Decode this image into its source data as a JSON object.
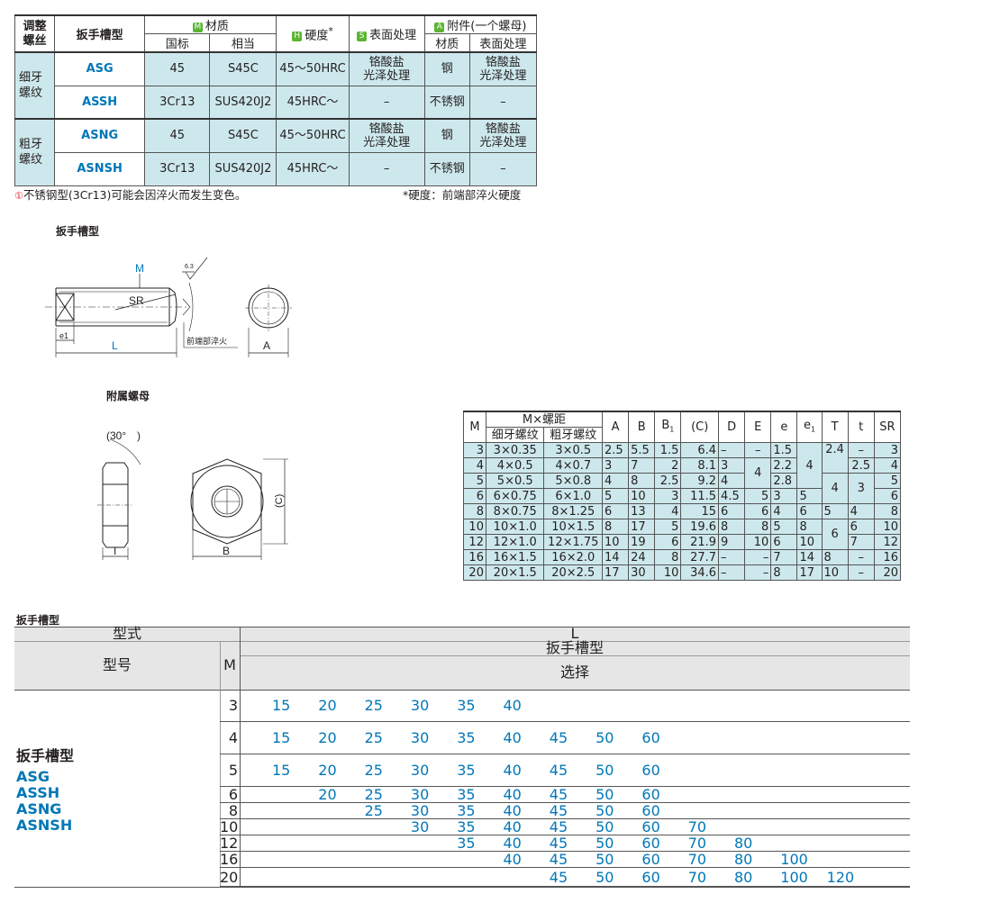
{
  "mat_table": {
    "h_adjust": "调整\n螺丝",
    "h_wrench": "扳手槽型",
    "h_material": "材质",
    "h_gb": "国标",
    "h_equiv": "相当",
    "h_hardness": "硬度",
    "h_hardness_star": "*",
    "h_surface": "表面处理",
    "h_attach": "附件(一个螺母)",
    "h_attach_mat": "材质",
    "h_attach_surf": "表面处理",
    "badge_m": "M",
    "badge_h": "H",
    "badge_s": "S",
    "badge_a": "A",
    "groups": [
      {
        "thread": "细牙\n螺纹",
        "rows": [
          {
            "type": "ASG",
            "gb": "45",
            "equiv": "S45C",
            "hardness": "45～50HRC",
            "surface": "铬酸盐\n光泽处理",
            "a_mat": "钢",
            "a_surf": "铬酸盐\n光泽处理"
          },
          {
            "type": "ASSH",
            "gb": "3Cr13",
            "equiv": "SUS420J2",
            "hardness": "45HRC～",
            "surface": "–",
            "a_mat": "不锈钢",
            "a_surf": "–"
          }
        ]
      },
      {
        "thread": "粗牙\n螺纹",
        "rows": [
          {
            "type": "ASNG",
            "gb": "45",
            "equiv": "S45C",
            "hardness": "45～50HRC",
            "surface": "铬酸盐\n光泽处理",
            "a_mat": "钢",
            "a_surf": "铬酸盐\n光泽处理"
          },
          {
            "type": "ASNSH",
            "gb": "3Cr13",
            "equiv": "SUS420J2",
            "hardness": "45HRC～",
            "surface": "–",
            "a_mat": "不锈钢",
            "a_surf": "–"
          }
        ]
      }
    ]
  },
  "notes": {
    "left": "不锈钢型(3Cr13)可能会因淬火而发生变色。",
    "right": "*硬度：前端部淬火硬度"
  },
  "drawing1": {
    "title": "扳手槽型",
    "m": "M",
    "sr": "SR",
    "roughness": "6.3",
    "e1": "e1",
    "l": "L",
    "a": "A",
    "tip": "前端部淬火"
  },
  "drawing2": {
    "title": "附属螺母",
    "angle": "(30°",
    "angle_close": ")",
    "t": "T",
    "b": "B",
    "c": "(C)"
  },
  "dim_table": {
    "h_m": "M",
    "h_mx": "M×螺距",
    "h_fine": "细牙螺纹",
    "h_coarse": "粗牙螺纹",
    "h_A": "A",
    "h_B": "B",
    "h_B1": "B",
    "h_B1_sub": "1",
    "h_C": "(C)",
    "h_D": "D",
    "h_E": "E",
    "h_e": "e",
    "h_e1": "e",
    "h_e1_sub": "1",
    "h_T": "T",
    "h_t": "t",
    "h_SR": "SR",
    "rows": [
      {
        "m": "3",
        "fine": "3×0.35",
        "coarse": "3×0.5",
        "A": "2.5",
        "B": "5.5",
        "B1": "1.5",
        "C": "6.4",
        "D": "–",
        "E": "–",
        "e": "1.5",
        "SR": "3"
      },
      {
        "m": "4",
        "fine": "4×0.5",
        "coarse": "4×0.7",
        "A": "3",
        "B": "7",
        "B1": "2",
        "C": "8.1",
        "D": "3",
        "e": "2.2",
        "SR": "4"
      },
      {
        "m": "5",
        "fine": "5×0.5",
        "coarse": "5×0.8",
        "A": "4",
        "B": "8",
        "B1": "2.5",
        "C": "9.2",
        "D": "4",
        "e": "2.8",
        "SR": "5"
      },
      {
        "m": "6",
        "fine": "6×0.75",
        "coarse": "6×1.0",
        "A": "5",
        "B": "10",
        "B1": "3",
        "C": "11.5",
        "D": "4.5",
        "E": "5",
        "e": "3",
        "e1": "5",
        "SR": "6"
      },
      {
        "m": "8",
        "fine": "8×0.75",
        "coarse": "8×1.25",
        "A": "6",
        "B": "13",
        "B1": "4",
        "C": "15",
        "D": "6",
        "E": "6",
        "e": "4",
        "e1": "6",
        "T": "5",
        "t": "4",
        "SR": "8"
      },
      {
        "m": "10",
        "fine": "10×1.0",
        "coarse": "10×1.5",
        "A": "8",
        "B": "17",
        "B1": "5",
        "C": "19.6",
        "D": "8",
        "E": "8",
        "e": "5",
        "e1": "8",
        "t": "6",
        "SR": "10"
      },
      {
        "m": "12",
        "fine": "12×1.0",
        "coarse": "12×1.75",
        "A": "10",
        "B": "19",
        "B1": "6",
        "C": "21.9",
        "D": "9",
        "E": "10",
        "e": "6",
        "e1": "10",
        "t": "7",
        "SR": "12"
      },
      {
        "m": "16",
        "fine": "16×1.5",
        "coarse": "16×2.0",
        "A": "14",
        "B": "24",
        "B1": "8",
        "C": "27.7",
        "D": "–",
        "E": "–",
        "e": "7",
        "e1": "14",
        "T": "8",
        "t": "–",
        "SR": "16"
      },
      {
        "m": "20",
        "fine": "20×1.5",
        "coarse": "20×2.5",
        "A": "17",
        "B": "30",
        "B1": "10",
        "C": "34.6",
        "D": "–",
        "E": "–",
        "e": "8",
        "e1": "17",
        "T": "10",
        "t": "–",
        "SR": "20"
      }
    ],
    "merged": {
      "E_4_5": "4",
      "e1_3_5": "4",
      "T_3_4": "2.4",
      "T_4_5": "4",
      "t_3": "–",
      "t_4": "2.5",
      "t_5_6": "3",
      "T_10_12": "6"
    }
  },
  "sel": {
    "title": "扳手槽型",
    "h_style": "型式",
    "h_L": "L",
    "h_model": "型号",
    "h_M": "M",
    "h_wrench": "扳手槽型",
    "h_select": "选择",
    "left_title": "扳手槽型",
    "types": [
      "ASG",
      "ASSH",
      "ASNG",
      "ASNSH"
    ],
    "columns": [
      "15",
      "20",
      "25",
      "30",
      "35",
      "40",
      "45",
      "50",
      "60",
      "70",
      "80",
      "100",
      "120"
    ],
    "rows": [
      {
        "m": "3",
        "values": [
          "15",
          "20",
          "25",
          "30",
          "35",
          "40"
        ]
      },
      {
        "m": "4",
        "values": [
          "15",
          "20",
          "25",
          "30",
          "35",
          "40",
          "45",
          "50",
          "60"
        ]
      },
      {
        "m": "5",
        "values": [
          "15",
          "20",
          "25",
          "30",
          "35",
          "40",
          "45",
          "50",
          "60"
        ]
      },
      {
        "m": "6",
        "values": [
          "20",
          "25",
          "30",
          "35",
          "40",
          "45",
          "50",
          "60"
        ]
      },
      {
        "m": "8",
        "values": [
          "25",
          "30",
          "35",
          "40",
          "45",
          "50",
          "60"
        ]
      },
      {
        "m": "10",
        "values": [
          "30",
          "35",
          "40",
          "45",
          "50",
          "60",
          "70"
        ]
      },
      {
        "m": "12",
        "values": [
          "35",
          "40",
          "45",
          "50",
          "60",
          "70",
          "80"
        ]
      },
      {
        "m": "16",
        "values": [
          "40",
          "45",
          "50",
          "60",
          "70",
          "80",
          "100"
        ]
      },
      {
        "m": "20",
        "values": [
          "45",
          "50",
          "60",
          "70",
          "80",
          "100",
          "120"
        ]
      }
    ]
  }
}
